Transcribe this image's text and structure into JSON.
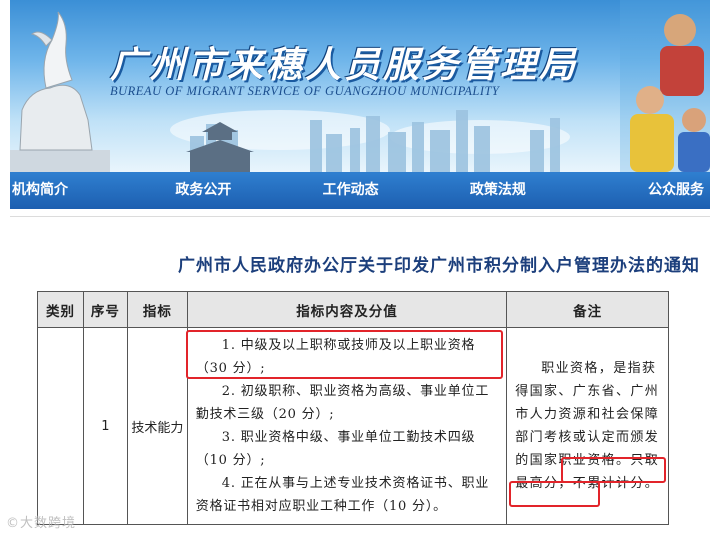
{
  "banner": {
    "title": "广州市来穗人员服务管理局",
    "subtitle": "BUREAU OF MIGRANT SERVICE OF GUANGZHOU MUNICIPALITY"
  },
  "nav": {
    "items": [
      "机构简介",
      "政务公开",
      "工作动态",
      "政策法规",
      "公众服务"
    ]
  },
  "notice": {
    "title": "广州市人民政府办公厅关于印发广州市积分制入户管理办法的通知"
  },
  "table": {
    "headers": [
      "类别",
      "序号",
      "指标",
      "指标内容及分值",
      "备注"
    ],
    "row": {
      "seq": "1",
      "indicator": "技术能力",
      "content": [
        "1. 中级及以上职称或技师及以上职业资格（30 分）;",
        "2. 初级职称、职业资格为高级、事业单位工勤技术三级（20 分）;",
        "3. 职业资格中级、事业单位工勤技术四级（10 分）;",
        "4. 正在从事与上述专业技术资格证书、职业资格证书相对应职业工种工作（10 分）。"
      ],
      "note": "职业资格，是指获得国家、广东省、广州市人力资源和社会保障部门考核或认定而颁发的国家职业资格。只取最高分，不累计计分。"
    }
  },
  "watermark": "©大数跨境",
  "colors": {
    "nav_bg": "#1d5fb0",
    "title_color": "#1c3f7c",
    "highlight": "#e2242a",
    "header_bg": "#e6e6e6"
  }
}
